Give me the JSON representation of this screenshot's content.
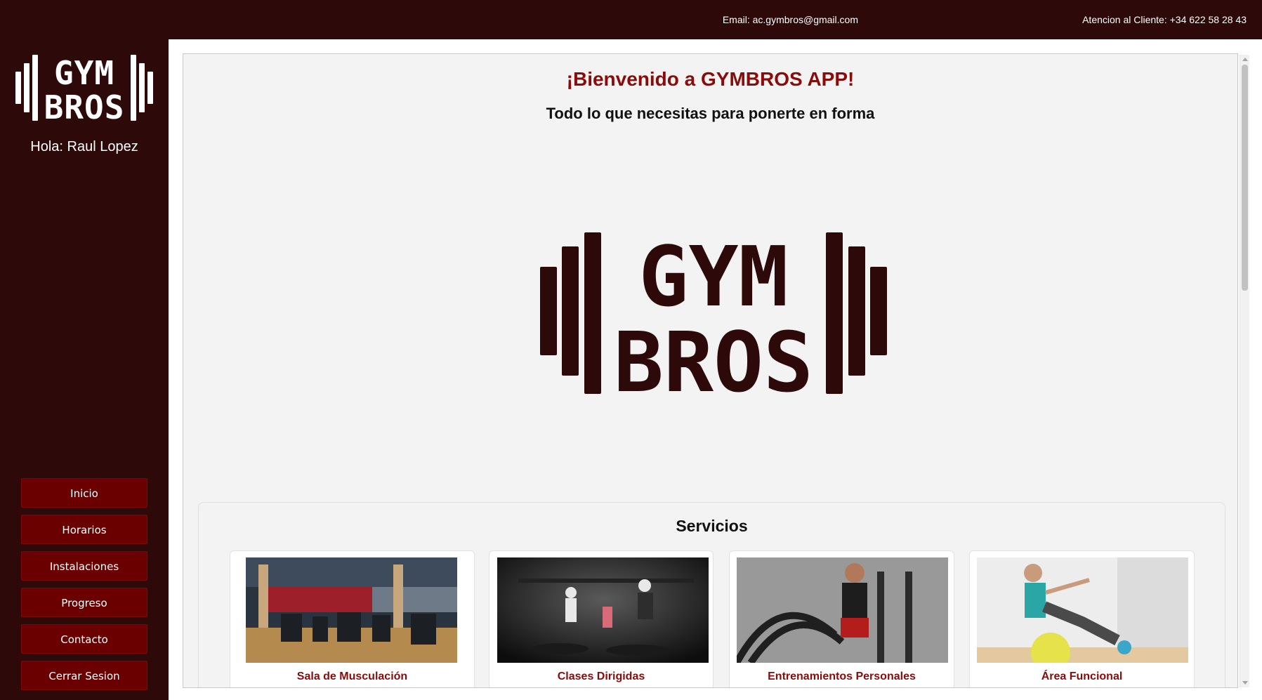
{
  "topbar": {
    "email": "Email: ac.gymbros@gmail.com",
    "phone": "Atencion al Cliente: +34 622 58 28 43"
  },
  "sidebar": {
    "logo_text": "GYM BROS",
    "greeting": "Hola: Raul Lopez",
    "nav": [
      {
        "label": "Inicio"
      },
      {
        "label": "Horarios"
      },
      {
        "label": "Instalaciones"
      },
      {
        "label": "Progreso"
      },
      {
        "label": "Contacto"
      },
      {
        "label": "Cerrar Sesion"
      }
    ]
  },
  "main": {
    "welcome": "¡Bienvenido a GYMBROS APP!",
    "subtitle": "Todo lo que necesitas para ponerte en forma",
    "logo_text": "GYM BROS"
  },
  "services": {
    "title": "Servicios",
    "cards": [
      {
        "label": "Sala de Musculación"
      },
      {
        "label": "Clases Dirigidas"
      },
      {
        "label": "Entrenamientos Personales"
      },
      {
        "label": "Área Funcional"
      }
    ]
  },
  "colors": {
    "brand_dark": "#2e0909",
    "button": "#6b0000",
    "accent_text": "#8b0a0a"
  }
}
